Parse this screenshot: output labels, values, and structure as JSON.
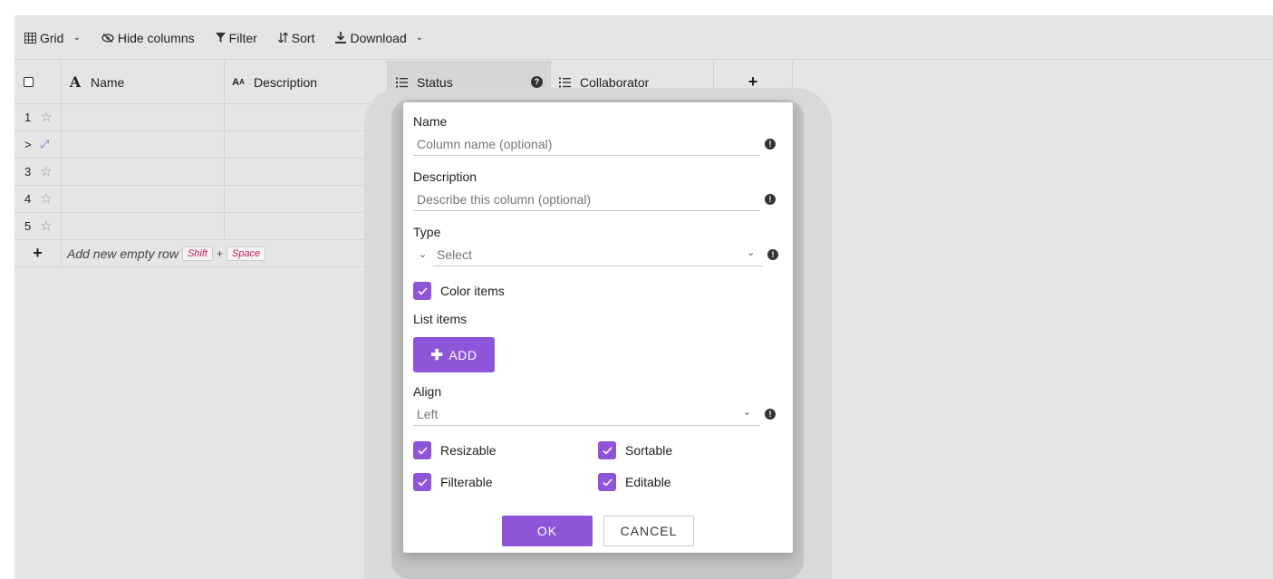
{
  "toolbar": {
    "grid_label": "Grid",
    "hide_columns_label": "Hide columns",
    "filter_label": "Filter",
    "sort_label": "Sort",
    "download_label": "Download"
  },
  "grid": {
    "columns": [
      {
        "label": "Name",
        "icon": "text-type-icon"
      },
      {
        "label": "Description",
        "icon": "text-small-type-icon"
      },
      {
        "label": "Status",
        "icon": "list-type-icon"
      },
      {
        "label": "Collaborator",
        "icon": "list-type-icon"
      }
    ],
    "add_column_label": "+",
    "rows": [
      "1",
      ">",
      "3",
      "4",
      "5"
    ],
    "add_row": {
      "plus": "+",
      "label": "Add new empty row",
      "key1": "Shift",
      "plus_sign": "+",
      "key2": "Space"
    }
  },
  "dialog": {
    "name_label": "Name",
    "name_placeholder": "Column name (optional)",
    "description_label": "Description",
    "description_placeholder": "Describe this column (optional)",
    "type_label": "Type",
    "type_value": "Select",
    "color_items_label": "Color items",
    "color_items_checked": true,
    "list_items_label": "List items",
    "add_label": "ADD",
    "align_label": "Align",
    "align_value": "Left",
    "resizable_label": "Resizable",
    "sortable_label": "Sortable",
    "filterable_label": "Filterable",
    "editable_label": "Editable",
    "ok_label": "OK",
    "cancel_label": "CANCEL"
  },
  "colors": {
    "accent": "#8e55d9"
  }
}
